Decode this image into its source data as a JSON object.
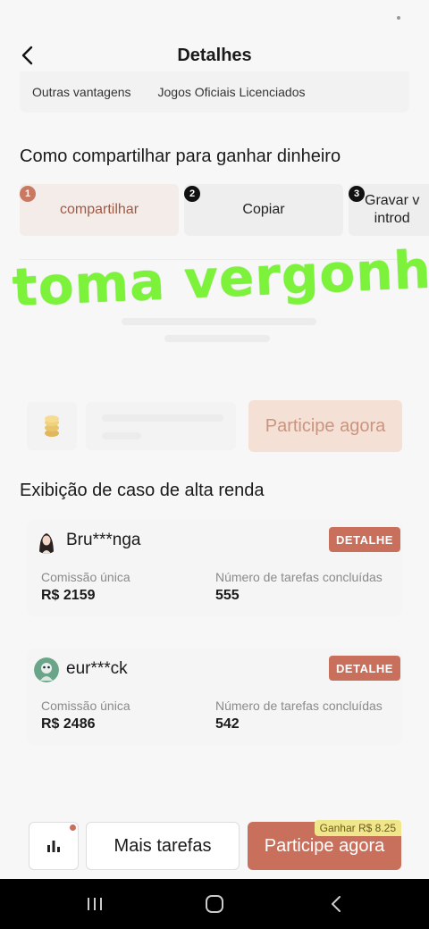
{
  "header": {
    "title": "Detalhes"
  },
  "vantagens": {
    "items": [
      "Outras vantagens",
      "Jogos Oficiais Licenciados"
    ]
  },
  "share": {
    "title": "Como compartilhar para ganhar dinheiro",
    "steps": [
      {
        "num": "1",
        "label": "compartilhar"
      },
      {
        "num": "2",
        "label": "Copiar"
      },
      {
        "num": "3",
        "label": "Gravar v",
        "label2": "introd"
      }
    ]
  },
  "overlay": {
    "text": "toma vergonha"
  },
  "promo": {
    "join_label": "Participe agora"
  },
  "cases": {
    "title": "Exibição de caso de alta renda",
    "items": [
      {
        "name": "Bru***nga",
        "detail": "DETALHE",
        "commission_label": "Comissão única",
        "commission_value": "R$ 2159",
        "tasks_label": "Número de tarefas concluídas",
        "tasks_value": "555"
      },
      {
        "name": "eur***ck",
        "detail": "DETALHE",
        "commission_label": "Comissão única",
        "commission_value": "R$ 2486",
        "tasks_label": "Número de tarefas concluídas",
        "tasks_value": "542"
      }
    ]
  },
  "bottom": {
    "more_label": "Mais tarefas",
    "join_label": "Participe agora",
    "earn_badge": "Ganhar R$ 8.25"
  },
  "colors": {
    "accent": "#c9705c",
    "overlay_green": "#7cf23a"
  },
  "icons": {
    "back": "chevron-left-icon",
    "chart": "bar-chart-icon",
    "coin": "coin-stack-icon"
  }
}
